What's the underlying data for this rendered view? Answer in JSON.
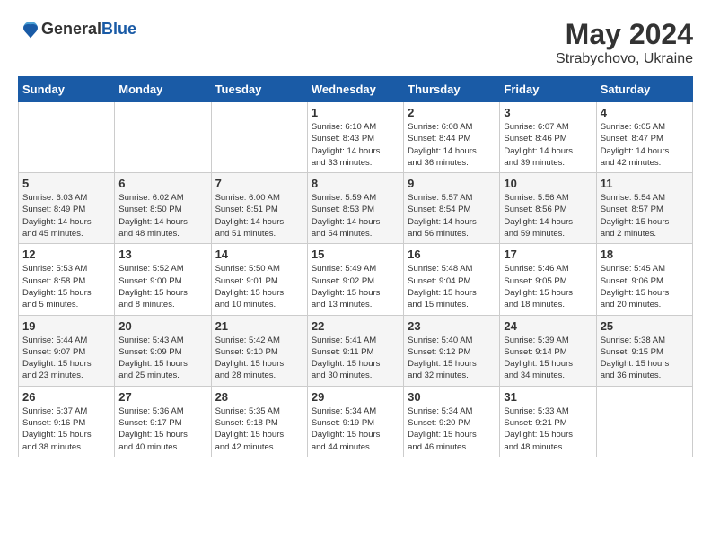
{
  "header": {
    "logo": {
      "general": "General",
      "blue": "Blue"
    },
    "title": "May 2024",
    "location": "Strabychovo, Ukraine"
  },
  "weekdays": [
    "Sunday",
    "Monday",
    "Tuesday",
    "Wednesday",
    "Thursday",
    "Friday",
    "Saturday"
  ],
  "weeks": [
    [
      {
        "day": "",
        "info": ""
      },
      {
        "day": "",
        "info": ""
      },
      {
        "day": "",
        "info": ""
      },
      {
        "day": "1",
        "info": "Sunrise: 6:10 AM\nSunset: 8:43 PM\nDaylight: 14 hours\nand 33 minutes."
      },
      {
        "day": "2",
        "info": "Sunrise: 6:08 AM\nSunset: 8:44 PM\nDaylight: 14 hours\nand 36 minutes."
      },
      {
        "day": "3",
        "info": "Sunrise: 6:07 AM\nSunset: 8:46 PM\nDaylight: 14 hours\nand 39 minutes."
      },
      {
        "day": "4",
        "info": "Sunrise: 6:05 AM\nSunset: 8:47 PM\nDaylight: 14 hours\nand 42 minutes."
      }
    ],
    [
      {
        "day": "5",
        "info": "Sunrise: 6:03 AM\nSunset: 8:49 PM\nDaylight: 14 hours\nand 45 minutes."
      },
      {
        "day": "6",
        "info": "Sunrise: 6:02 AM\nSunset: 8:50 PM\nDaylight: 14 hours\nand 48 minutes."
      },
      {
        "day": "7",
        "info": "Sunrise: 6:00 AM\nSunset: 8:51 PM\nDaylight: 14 hours\nand 51 minutes."
      },
      {
        "day": "8",
        "info": "Sunrise: 5:59 AM\nSunset: 8:53 PM\nDaylight: 14 hours\nand 54 minutes."
      },
      {
        "day": "9",
        "info": "Sunrise: 5:57 AM\nSunset: 8:54 PM\nDaylight: 14 hours\nand 56 minutes."
      },
      {
        "day": "10",
        "info": "Sunrise: 5:56 AM\nSunset: 8:56 PM\nDaylight: 14 hours\nand 59 minutes."
      },
      {
        "day": "11",
        "info": "Sunrise: 5:54 AM\nSunset: 8:57 PM\nDaylight: 15 hours\nand 2 minutes."
      }
    ],
    [
      {
        "day": "12",
        "info": "Sunrise: 5:53 AM\nSunset: 8:58 PM\nDaylight: 15 hours\nand 5 minutes."
      },
      {
        "day": "13",
        "info": "Sunrise: 5:52 AM\nSunset: 9:00 PM\nDaylight: 15 hours\nand 8 minutes."
      },
      {
        "day": "14",
        "info": "Sunrise: 5:50 AM\nSunset: 9:01 PM\nDaylight: 15 hours\nand 10 minutes."
      },
      {
        "day": "15",
        "info": "Sunrise: 5:49 AM\nSunset: 9:02 PM\nDaylight: 15 hours\nand 13 minutes."
      },
      {
        "day": "16",
        "info": "Sunrise: 5:48 AM\nSunset: 9:04 PM\nDaylight: 15 hours\nand 15 minutes."
      },
      {
        "day": "17",
        "info": "Sunrise: 5:46 AM\nSunset: 9:05 PM\nDaylight: 15 hours\nand 18 minutes."
      },
      {
        "day": "18",
        "info": "Sunrise: 5:45 AM\nSunset: 9:06 PM\nDaylight: 15 hours\nand 20 minutes."
      }
    ],
    [
      {
        "day": "19",
        "info": "Sunrise: 5:44 AM\nSunset: 9:07 PM\nDaylight: 15 hours\nand 23 minutes."
      },
      {
        "day": "20",
        "info": "Sunrise: 5:43 AM\nSunset: 9:09 PM\nDaylight: 15 hours\nand 25 minutes."
      },
      {
        "day": "21",
        "info": "Sunrise: 5:42 AM\nSunset: 9:10 PM\nDaylight: 15 hours\nand 28 minutes."
      },
      {
        "day": "22",
        "info": "Sunrise: 5:41 AM\nSunset: 9:11 PM\nDaylight: 15 hours\nand 30 minutes."
      },
      {
        "day": "23",
        "info": "Sunrise: 5:40 AM\nSunset: 9:12 PM\nDaylight: 15 hours\nand 32 minutes."
      },
      {
        "day": "24",
        "info": "Sunrise: 5:39 AM\nSunset: 9:14 PM\nDaylight: 15 hours\nand 34 minutes."
      },
      {
        "day": "25",
        "info": "Sunrise: 5:38 AM\nSunset: 9:15 PM\nDaylight: 15 hours\nand 36 minutes."
      }
    ],
    [
      {
        "day": "26",
        "info": "Sunrise: 5:37 AM\nSunset: 9:16 PM\nDaylight: 15 hours\nand 38 minutes."
      },
      {
        "day": "27",
        "info": "Sunrise: 5:36 AM\nSunset: 9:17 PM\nDaylight: 15 hours\nand 40 minutes."
      },
      {
        "day": "28",
        "info": "Sunrise: 5:35 AM\nSunset: 9:18 PM\nDaylight: 15 hours\nand 42 minutes."
      },
      {
        "day": "29",
        "info": "Sunrise: 5:34 AM\nSunset: 9:19 PM\nDaylight: 15 hours\nand 44 minutes."
      },
      {
        "day": "30",
        "info": "Sunrise: 5:34 AM\nSunset: 9:20 PM\nDaylight: 15 hours\nand 46 minutes."
      },
      {
        "day": "31",
        "info": "Sunrise: 5:33 AM\nSunset: 9:21 PM\nDaylight: 15 hours\nand 48 minutes."
      },
      {
        "day": "",
        "info": ""
      }
    ]
  ]
}
